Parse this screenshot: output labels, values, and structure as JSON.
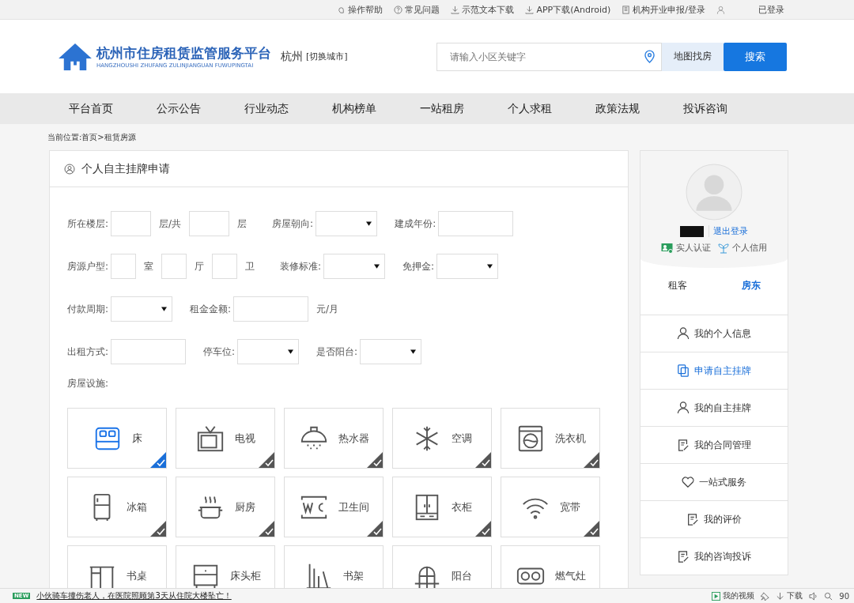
{
  "top_links": [
    "操作帮助",
    "常见问题",
    "示范文本下载",
    "APP下载(Android)",
    "机构开业申报/登录"
  ],
  "login_status": "已登录",
  "logo": {
    "title": "杭州市住房租赁监管服务平台",
    "subtitle": "HANGZHOUSHI ZHUFANG ZULINJIANGUAN FUWUPINGTAI"
  },
  "city": "杭州",
  "switch_city": "[切换城市]",
  "search": {
    "placeholder": "请输入小区关键字",
    "map_button": "地图找房",
    "search_button": "搜索"
  },
  "nav": [
    "平台首页",
    "公示公告",
    "行业动态",
    "机构榜单",
    "一站租房",
    "个人求租",
    "政策法规",
    "投诉咨询"
  ],
  "breadcrumb": "当前位置:首页>租赁房源",
  "form": {
    "title": "个人自主挂牌申请",
    "rows": [
      {
        "fields": [
          {
            "label": "所在楼层:",
            "controls": [
              {
                "kind": "input"
              },
              {
                "kind": "unit",
                "text": "层/共"
              },
              {
                "kind": "input"
              },
              {
                "kind": "unit",
                "text": "层"
              }
            ]
          },
          {
            "label": "房屋朝向:",
            "controls": [
              {
                "kind": "select"
              }
            ]
          },
          {
            "label": "建成年份:",
            "controls": [
              {
                "kind": "input"
              }
            ]
          }
        ]
      },
      {
        "fields": [
          {
            "label": "房源户型:",
            "controls": [
              {
                "kind": "input"
              },
              {
                "kind": "unit",
                "text": "室"
              },
              {
                "kind": "input"
              },
              {
                "kind": "unit",
                "text": "厅"
              },
              {
                "kind": "input"
              },
              {
                "kind": "unit",
                "text": "卫"
              }
            ]
          },
          {
            "label": "装修标准:",
            "controls": [
              {
                "kind": "select"
              }
            ]
          },
          {
            "label": "免押金:",
            "controls": [
              {
                "kind": "select"
              }
            ]
          }
        ]
      },
      {
        "fields": [
          {
            "label": "付款周期:",
            "controls": [
              {
                "kind": "select"
              }
            ]
          },
          {
            "label": "租金金额:",
            "controls": [
              {
                "kind": "input"
              },
              {
                "kind": "unit",
                "text": "元/月"
              }
            ]
          }
        ]
      },
      {
        "fields": [
          {
            "label": "出租方式:",
            "controls": [
              {
                "kind": "input"
              }
            ]
          },
          {
            "label": "停车位:",
            "controls": [
              {
                "kind": "select"
              }
            ]
          },
          {
            "label": "是否阳台:",
            "controls": [
              {
                "kind": "select"
              }
            ]
          }
        ]
      }
    ],
    "facilities_label": "房屋设施:",
    "facilities": [
      {
        "label": "床",
        "selected": true
      },
      {
        "label": "电视",
        "selected": false
      },
      {
        "label": "热水器",
        "selected": false
      },
      {
        "label": "空调",
        "selected": false
      },
      {
        "label": "洗衣机",
        "selected": false
      },
      {
        "label": "冰箱",
        "selected": false
      },
      {
        "label": "厨房",
        "selected": false
      },
      {
        "label": "卫生间",
        "selected": false
      },
      {
        "label": "衣柜",
        "selected": false
      },
      {
        "label": "宽带",
        "selected": false
      },
      {
        "label": "书桌",
        "selected": false
      },
      {
        "label": "床头柜",
        "selected": false
      },
      {
        "label": "书架",
        "selected": false
      },
      {
        "label": "阳台",
        "selected": false
      },
      {
        "label": "燃气灶",
        "selected": false
      }
    ]
  },
  "sidebar": {
    "logout": "退出登录",
    "badges": [
      "实人认证",
      "个人信用"
    ],
    "roles": [
      {
        "label": "租客",
        "selected": false
      },
      {
        "label": "房东",
        "selected": true
      }
    ],
    "menu": [
      {
        "label": "我的个人信息",
        "selected": false
      },
      {
        "label": "申请自主挂牌",
        "selected": true
      },
      {
        "label": "我的自主挂牌",
        "selected": false
      },
      {
        "label": "我的合同管理",
        "selected": false
      },
      {
        "label": "一站式服务",
        "selected": false
      },
      {
        "label": "我的评价",
        "selected": false
      },
      {
        "label": "我的咨询投诉",
        "selected": false
      }
    ]
  },
  "status_bar": {
    "badge": "NEW",
    "news": "小伙骑车撞伤老人，在医院照顾第3天从住院大楼坠亡！",
    "video": "我的视频",
    "download": "下载",
    "zoom": "90"
  }
}
